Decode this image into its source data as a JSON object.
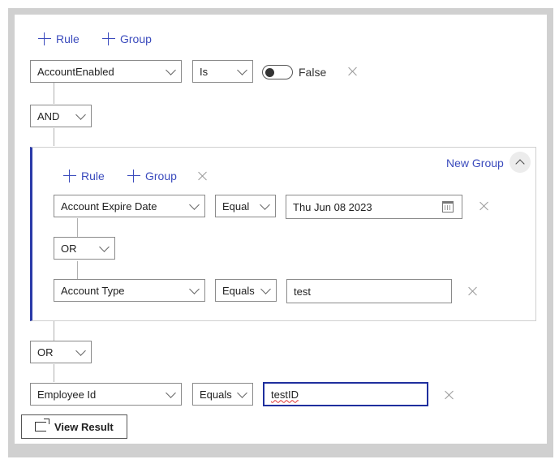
{
  "toolbar": {
    "rule_label": "Rule",
    "group_label": "Group"
  },
  "rules": {
    "row1": {
      "field": "AccountEnabled",
      "operator": "Is",
      "toggle_value": "False",
      "toggle_on": false
    },
    "join1": "AND",
    "group": {
      "title": "New Group",
      "rule_label": "Rule",
      "group_label": "Group",
      "row1": {
        "field": "Account Expire Date",
        "operator": "Equal",
        "value": "Thu Jun 08 2023"
      },
      "join": "OR",
      "row2": {
        "field": "Account Type",
        "operator": "Equals",
        "value": "test"
      }
    },
    "join2": "OR",
    "row3": {
      "field": "Employee Id",
      "operator": "Equals",
      "value": "testID"
    }
  },
  "footer": {
    "view_result_label": "View Result"
  },
  "colors": {
    "accent": "#3b4bbd",
    "group_border": "#2a3aa8",
    "focus_border": "#1f2f9e",
    "border": "#8a8a8a"
  }
}
